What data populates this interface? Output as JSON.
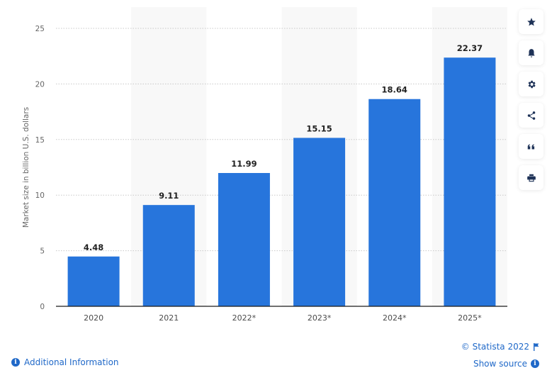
{
  "chart_data": {
    "type": "bar",
    "title": "",
    "xlabel": "",
    "ylabel": "Market size in billion U.S. dollars",
    "categories": [
      "2020",
      "2021",
      "2022*",
      "2023*",
      "2024*",
      "2025*"
    ],
    "values": [
      4.48,
      9.11,
      11.99,
      15.15,
      18.64,
      22.37
    ],
    "data_labels": [
      "4.48",
      "9.11",
      "11.99",
      "15.15",
      "18.64",
      "22.37"
    ],
    "ylim": [
      0,
      25
    ],
    "yticks": [
      0,
      5,
      10,
      15,
      20,
      25
    ],
    "grid": true,
    "legend": "none",
    "bar_color": "#2775dc",
    "alternate_band_color": "#f8f8f8"
  },
  "side_tools": [
    {
      "name": "favorite",
      "icon": "star-icon"
    },
    {
      "name": "notification",
      "icon": "bell-icon"
    },
    {
      "name": "settings",
      "icon": "gear-icon"
    },
    {
      "name": "share",
      "icon": "share-icon"
    },
    {
      "name": "cite",
      "icon": "quote-icon"
    },
    {
      "name": "print",
      "icon": "print-icon"
    }
  ],
  "footer": {
    "additional_info": "Additional Information",
    "copyright": "© Statista 2022",
    "show_source": "Show source",
    "info_glyph": "i"
  }
}
